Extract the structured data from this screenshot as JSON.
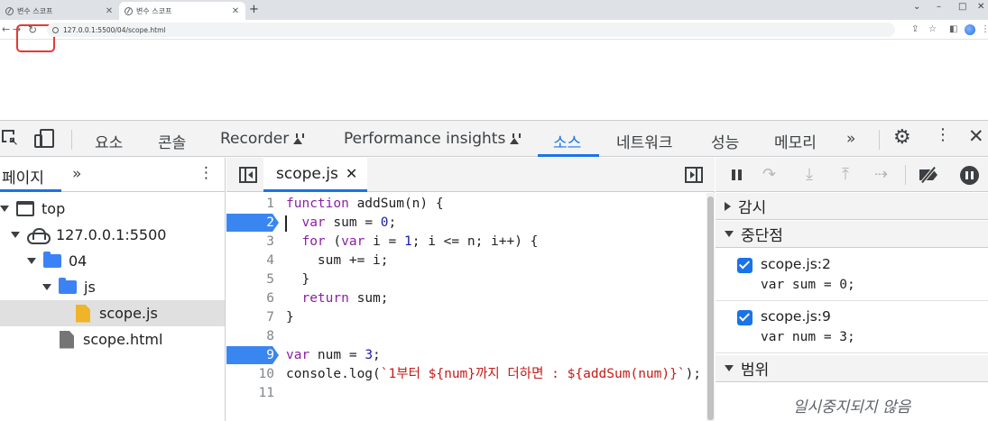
{
  "browser": {
    "tabs": [
      {
        "title": "변수 스코프",
        "active": false
      },
      {
        "title": "변수 스코프",
        "active": true
      }
    ],
    "url": "127.0.0.1:5500/04/scope.html",
    "window_controls": [
      "⌄",
      "–",
      "□",
      "✕"
    ]
  },
  "devtools": {
    "tabs": [
      "요소",
      "콘솔",
      "Recorder",
      "Performance insights",
      "소스",
      "네트워크",
      "성능",
      "메모리",
      "»"
    ],
    "active_tab": "소스",
    "navigator": {
      "tab": "페이지",
      "more": "»",
      "tree": [
        {
          "label": "top",
          "icon": "frame-icon",
          "expanded": true
        },
        {
          "label": "127.0.0.1:5500",
          "icon": "cloud-icon",
          "expanded": true
        },
        {
          "label": "04",
          "icon": "folder-icon",
          "expanded": true
        },
        {
          "label": "js",
          "icon": "folder-icon",
          "expanded": true
        },
        {
          "label": "scope.js",
          "icon": "js-file-icon",
          "selected": true
        },
        {
          "label": "scope.html",
          "icon": "file-icon"
        }
      ]
    },
    "editor": {
      "file_tab": "scope.js",
      "line_numbers": [
        "1",
        "2",
        "3",
        "4",
        "5",
        "6",
        "7",
        "8",
        "9",
        "10",
        "11"
      ],
      "breakpoint_lines": [
        2,
        9
      ],
      "lines": [
        "function addSum(n) {",
        "  var sum = 0;",
        "  for (var i = 1; i <= n; i++) {",
        "    sum += i;",
        "  }",
        "  return sum;",
        "}",
        "",
        "var num = 3;",
        "console.log(`1부터 ${num}까지 더하면 : ${addSum(num)}`);",
        ""
      ]
    },
    "debugger": {
      "watch": "감시",
      "breakpoints_header": "중단점",
      "breakpoints": [
        {
          "location": "scope.js:2",
          "code": "var sum = 0;",
          "checked": true
        },
        {
          "location": "scope.js:9",
          "code": "var num = 3;",
          "checked": true
        }
      ],
      "scope_header": "범위",
      "not_paused": "일시중지되지 않음"
    }
  },
  "colors": {
    "accent": "#1a73e8",
    "breakpoint": "#3a86f0",
    "keyword": "#8b1fa4",
    "number": "#1a1aa6",
    "string": "#c41a16",
    "highlight_box": "#e53935"
  }
}
